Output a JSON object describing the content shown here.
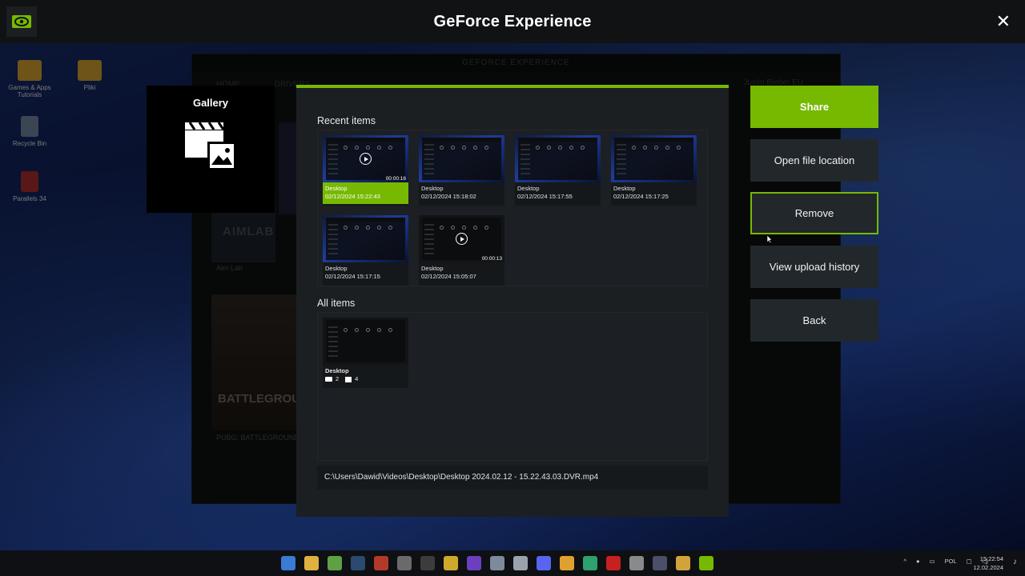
{
  "app": {
    "title": "GeForce Experience",
    "close_icon": "close-icon",
    "accent": "#76b900"
  },
  "desktop": {
    "icons": [
      {
        "label": "Games & Apps Tutorials"
      },
      {
        "label": "Pliki"
      },
      {
        "label": "Recycle Bin"
      },
      {
        "label": "Parallels 34"
      }
    ]
  },
  "background_window": {
    "title": "GEFORCE EXPERIENCE",
    "nav": [
      "HOME",
      "DRIVERS"
    ],
    "user": "Justin Bieber EU",
    "games": [
      "Aim Lab",
      "PUBG: BATTLEGROUNDS"
    ],
    "aimlab_logo": "AIMLAB",
    "pubg_logo": "BATTLEGROUNDS"
  },
  "gallery_tile": {
    "title": "Gallery",
    "icon": "gallery-clapper-icon"
  },
  "gallery": {
    "recent_title": "Recent items",
    "recent_items": [
      {
        "name": "Desktop",
        "date": "02/12/2024 15:22:43",
        "duration": "00:00:16",
        "video": true,
        "selected": true
      },
      {
        "name": "Desktop",
        "date": "02/12/2024 15:18:02",
        "duration": "",
        "video": false,
        "selected": false
      },
      {
        "name": "Desktop",
        "date": "02/12/2024 15:17:55",
        "duration": "",
        "video": false,
        "selected": false
      },
      {
        "name": "Desktop",
        "date": "02/12/2024 15:17:25",
        "duration": "",
        "video": false,
        "selected": false
      },
      {
        "name": "Desktop",
        "date": "02/12/2024 15:17:15",
        "duration": "",
        "video": false,
        "selected": false
      },
      {
        "name": "Desktop",
        "date": "02/12/2024 15:05:07",
        "duration": "00:00:13",
        "video": true,
        "selected": false
      }
    ],
    "all_title": "All items",
    "all_items": [
      {
        "name": "Desktop",
        "video_count": "2",
        "image_count": "4"
      }
    ],
    "file_path": "C:\\Users\\Dawid\\Videos\\Desktop\\Desktop 2024.02.12 - 15.22.43.03.DVR.mp4"
  },
  "actions": {
    "share": "Share",
    "open_file_location": "Open file location",
    "remove": "Remove",
    "view_upload_history": "View upload history",
    "back": "Back"
  },
  "taskbar": {
    "lang": "POL",
    "time": "15:22:54",
    "date": "12.02.2024"
  }
}
